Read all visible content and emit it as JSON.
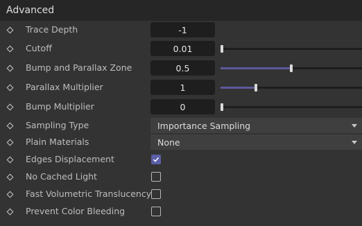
{
  "header": {
    "title": "Advanced"
  },
  "rows": [
    {
      "label": "Trace Depth",
      "value": "-1"
    },
    {
      "label": "Cutoff",
      "value": "0.01",
      "slider": 0.0
    },
    {
      "label": "Bump and Parallax Zone",
      "value": "0.5",
      "slider": 0.5
    },
    {
      "label": "Parallax Multiplier",
      "value": "1",
      "slider": 0.25
    },
    {
      "label": "Bump Multiplier",
      "value": "0",
      "slider": 0.0
    },
    {
      "label": "Sampling Type",
      "value": "Importance Sampling"
    },
    {
      "label": "Plain Materials",
      "value": "None"
    },
    {
      "label": "Edges Displacement",
      "checked": true
    },
    {
      "label": "No Cached Light",
      "checked": false
    },
    {
      "label": "Fast Volumetric Translucency",
      "checked": false
    },
    {
      "label": "Prevent Color Bleeding",
      "checked": false
    }
  ],
  "colors": {
    "accent": "#5b5ea8",
    "slider_fill": "#5d5a9c",
    "field_bg": "#1e1e1e",
    "panel_bg": "#333333"
  },
  "icons": {
    "row_marker": "diamond-icon",
    "dropdown": "triangle-down-icon",
    "check": "checkmark-icon"
  }
}
